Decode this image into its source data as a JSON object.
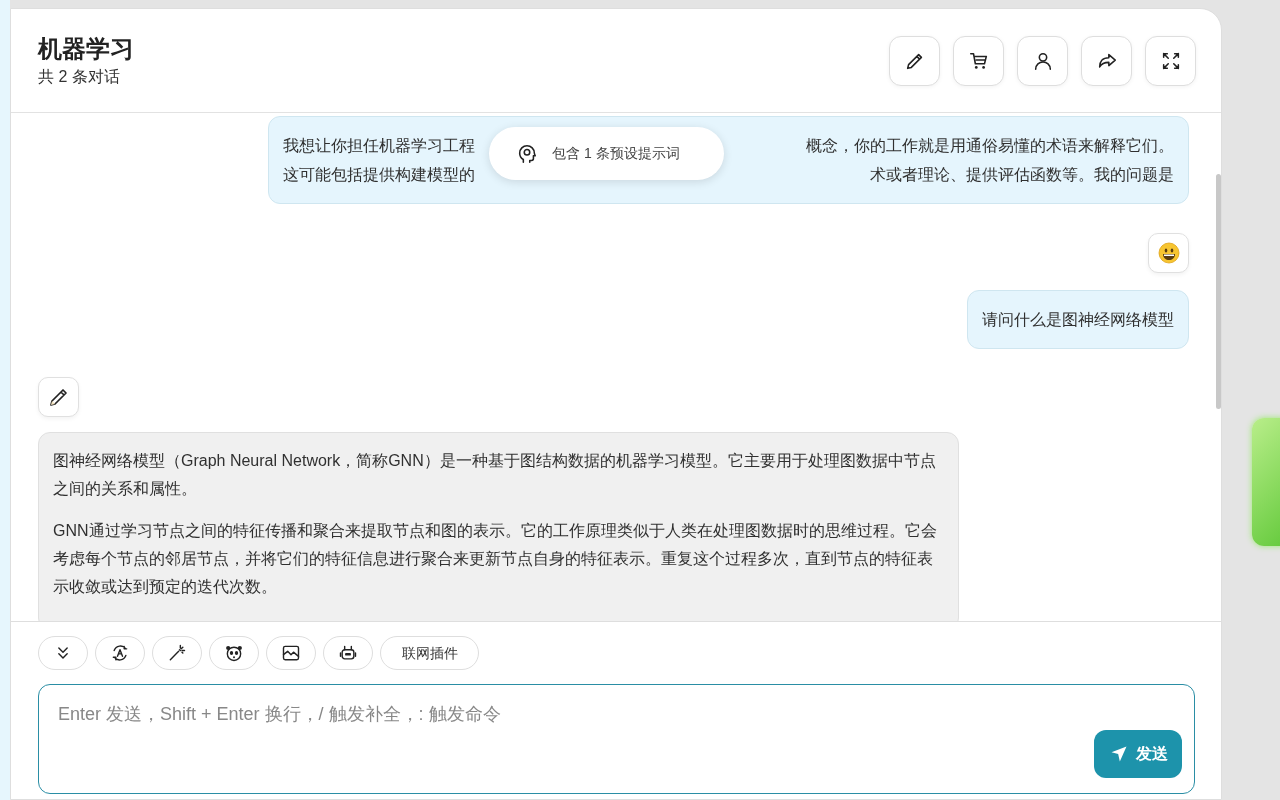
{
  "header": {
    "title": "机器学习",
    "subtitle": "共 2 条对话",
    "actions": [
      {
        "kind": "edit"
      },
      {
        "kind": "cart"
      },
      {
        "kind": "user"
      },
      {
        "kind": "share"
      },
      {
        "kind": "fullscreen"
      }
    ]
  },
  "prompt_popup": {
    "text": "包含 1 条预设提示词"
  },
  "messages": [
    {
      "kind": "user",
      "lines": [
        [
          "我想让你担任机器学习工程",
          "概念，你的工作就是用通俗易懂的术语来解释它们。"
        ],
        [
          "这可能包括提供构建模型的",
          "术或者理论、提供评估函数等。我的问题是"
        ]
      ]
    },
    {
      "kind": "user",
      "avatar": {
        "kind": "smiley"
      },
      "paragraphs": [
        "请问什么是图神经网络模型"
      ]
    },
    {
      "kind": "bot",
      "avatar": {
        "kind": "pencil"
      },
      "paragraphs": [
        "图神经网络模型（Graph Neural Network，简称GNN）是一种基于图结构数据的机器学习模型。它主要用于处理图数据中节点之间的关系和属性。",
        "GNN通过学习节点之间的特征传播和聚合来提取节点和图的表示。它的工作原理类似于人类在处理图数据时的思维过程。它会考虑每个节点的邻居节点，并将它们的特征信息进行聚合来更新节点自身的特征表示。重复这个过程多次，直到节点的特征表示收敛或达到预定的迭代次数。"
      ]
    }
  ],
  "toolbar": [
    {
      "kind": "scroll"
    },
    {
      "kind": "theme"
    },
    {
      "kind": "magic"
    },
    {
      "kind": "mask"
    },
    {
      "kind": "image"
    },
    {
      "kind": "robot"
    },
    {
      "kind": "text",
      "label": "联网插件"
    }
  ],
  "input": {
    "placeholder": "Enter 发送，Shift + Enter 换行，/ 触发补全，: 触发命令"
  },
  "send_button": {
    "label": "发送"
  }
}
